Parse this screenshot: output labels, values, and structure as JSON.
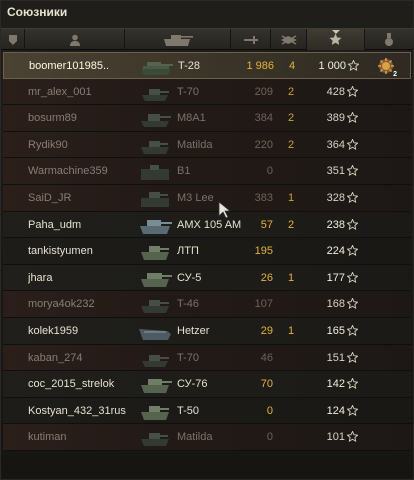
{
  "panel": {
    "title": "Союзники"
  },
  "header": {
    "columns": [
      {
        "id": "platoon",
        "icon": "platoon-icon"
      },
      {
        "id": "player",
        "icon": "player-icon"
      },
      {
        "id": "vehicle",
        "icon": "tank-silhouette-icon"
      },
      {
        "id": "damage",
        "icon": "damage-icon"
      },
      {
        "id": "frags",
        "icon": "frags-icon"
      },
      {
        "id": "xp",
        "icon": "star-icon"
      },
      {
        "id": "awards",
        "icon": "medal-icon"
      }
    ]
  },
  "rows": [
    {
      "name": "boomer101985..",
      "tank": "T-28",
      "damage": "1 986",
      "frags": "4",
      "xp": "1 000",
      "state": "player",
      "medal": true,
      "medal_count": "2"
    },
    {
      "name": "mr_alex_001",
      "tank": "T-70",
      "damage": "209",
      "frags": "2",
      "xp": "428",
      "state": "dead"
    },
    {
      "name": "bosurm89",
      "tank": "M8A1",
      "damage": "384",
      "frags": "2",
      "xp": "389",
      "state": "dead"
    },
    {
      "name": "Rydik90",
      "tank": "Matilda",
      "damage": "220",
      "frags": "2",
      "xp": "364",
      "state": "dead"
    },
    {
      "name": "Warmachine359",
      "tank": "B1",
      "damage": "0",
      "frags": "",
      "xp": "351",
      "state": "dead"
    },
    {
      "name": "SaiD_JR",
      "tank": "M3 Lee",
      "damage": "383",
      "frags": "1",
      "xp": "328",
      "state": "dead"
    },
    {
      "name": "Paha_udm",
      "tank": "AMX 105 AM",
      "damage": "57",
      "frags": "2",
      "xp": "238",
      "state": "alive"
    },
    {
      "name": "tankistyumen",
      "tank": "ЛТП",
      "damage": "195",
      "frags": "",
      "xp": "224",
      "state": "alive"
    },
    {
      "name": "jhara",
      "tank": "СУ-5",
      "damage": "26",
      "frags": "1",
      "xp": "177",
      "state": "alive"
    },
    {
      "name": "morya4ok232",
      "tank": "T-46",
      "damage": "107",
      "frags": "",
      "xp": "168",
      "state": "dead"
    },
    {
      "name": "kolek1959",
      "tank": "Hetzer",
      "damage": "29",
      "frags": "1",
      "xp": "165",
      "state": "alive"
    },
    {
      "name": "kaban_274",
      "tank": "T-70",
      "damage": "46",
      "frags": "",
      "xp": "151",
      "state": "dead"
    },
    {
      "name": "coc_2015_strelok",
      "tank": "СУ-76",
      "damage": "70",
      "frags": "",
      "xp": "142",
      "state": "alive"
    },
    {
      "name": "Kostyan_432_31rus",
      "tank": "T-50",
      "damage": "0",
      "frags": "",
      "xp": "124",
      "state": "alive"
    },
    {
      "name": "kutiman",
      "tank": "Matilda",
      "damage": "0",
      "frags": "",
      "xp": "101",
      "state": "dead"
    }
  ],
  "colors": {
    "damage_alive": "#e7b23a",
    "dead_row_tint": "#2a1f1b",
    "player_row": "#4a4233"
  }
}
